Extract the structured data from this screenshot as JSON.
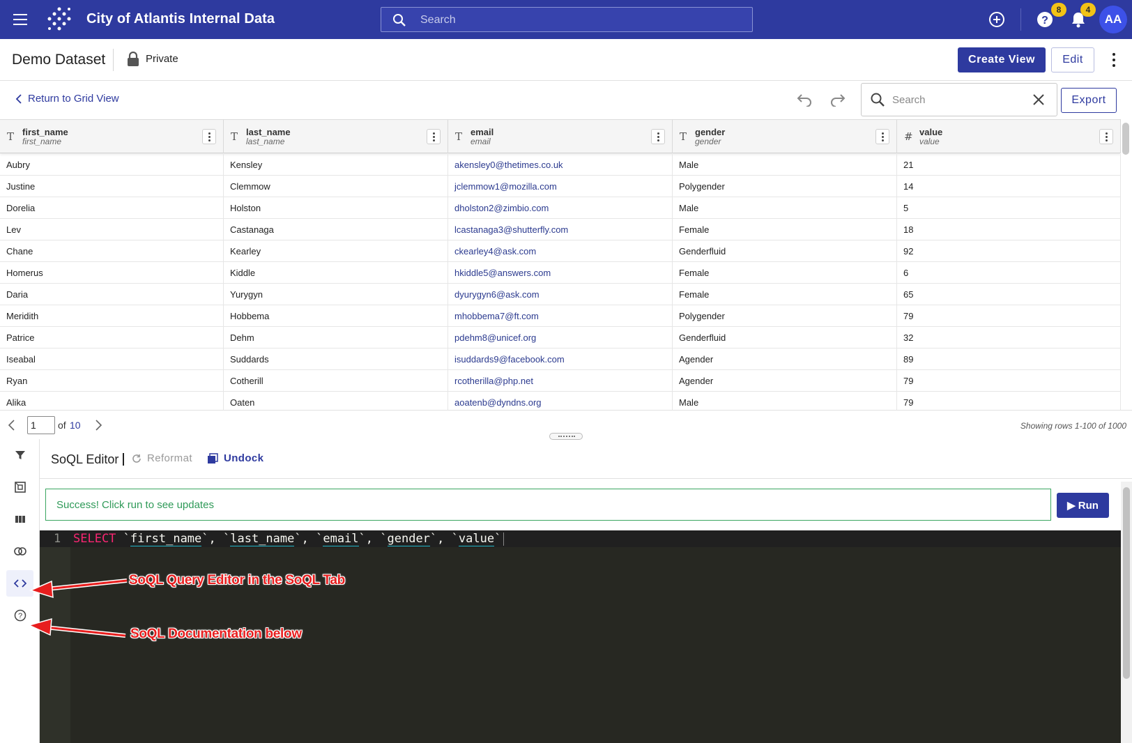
{
  "app": {
    "title": "City of Atlantis Internal Data",
    "search_placeholder": "Search",
    "help_badge": "8",
    "notifications_badge": "4",
    "avatar_initials": "AA",
    "brand_color": "#2e3a9f"
  },
  "dataset": {
    "title": "Demo Dataset",
    "visibility": "Private",
    "create_view_label": "Create View",
    "edit_label": "Edit"
  },
  "toolbar": {
    "return_label": "Return to Grid View",
    "search_placeholder": "Search",
    "export_label": "Export"
  },
  "grid": {
    "columns": [
      {
        "type_icon": "T",
        "name": "first_name",
        "field": "first_name"
      },
      {
        "type_icon": "T",
        "name": "last_name",
        "field": "last_name"
      },
      {
        "type_icon": "T",
        "name": "email",
        "field": "email"
      },
      {
        "type_icon": "T",
        "name": "gender",
        "field": "gender"
      },
      {
        "type_icon": "#",
        "name": "value",
        "field": "value"
      }
    ],
    "rows": [
      [
        "Aubry",
        "Kensley",
        "akensley0@thetimes.co.uk",
        "Male",
        "21"
      ],
      [
        "Justine",
        "Clemmow",
        "jclemmow1@mozilla.com",
        "Polygender",
        "14"
      ],
      [
        "Dorelia",
        "Holston",
        "dholston2@zimbio.com",
        "Male",
        "5"
      ],
      [
        "Lev",
        "Castanaga",
        "lcastanaga3@shutterfly.com",
        "Female",
        "18"
      ],
      [
        "Chane",
        "Kearley",
        "ckearley4@ask.com",
        "Genderfluid",
        "92"
      ],
      [
        "Homerus",
        "Kiddle",
        "hkiddle5@answers.com",
        "Female",
        "6"
      ],
      [
        "Daria",
        "Yurygyn",
        "dyurygyn6@ask.com",
        "Female",
        "65"
      ],
      [
        "Meridith",
        "Hobbema",
        "mhobbema7@ft.com",
        "Polygender",
        "79"
      ],
      [
        "Patrice",
        "Dehm",
        "pdehm8@unicef.org",
        "Genderfluid",
        "32"
      ],
      [
        "Iseabal",
        "Suddards",
        "isuddards9@facebook.com",
        "Agender",
        "89"
      ],
      [
        "Ryan",
        "Cotherill",
        "rcotherilla@php.net",
        "Agender",
        "79"
      ],
      [
        "Alika",
        "Oaten",
        "aoatenb@dyndns.org",
        "Male",
        "79"
      ]
    ]
  },
  "pager": {
    "current_page": "1",
    "of_label": "of",
    "total_pages": "10",
    "status": "Showing rows 1-100 of 1000"
  },
  "editor": {
    "title": "SoQL Editor",
    "reformat_label": "Reformat",
    "undock_label": "Undock",
    "message": "Success! Click run to see updates",
    "run_label": "▶ Run",
    "line_number": "1",
    "keyword": "SELECT",
    "fields": [
      "first_name",
      "last_name",
      "email",
      "gender",
      "value"
    ]
  },
  "side_rail": {
    "icons": [
      "filter-icon",
      "group-icon",
      "columns-icon",
      "join-icon",
      "code-icon",
      "help-circle-icon"
    ],
    "active": "code-icon"
  },
  "annotations": {
    "editor_note": "SoQL Query Editor in the SoQL Tab",
    "docs_note": "SoQL Documentation below"
  }
}
